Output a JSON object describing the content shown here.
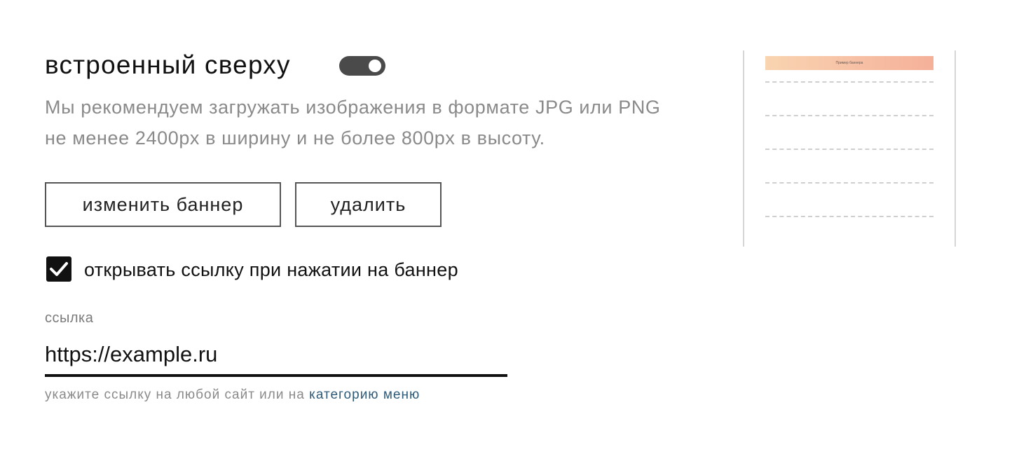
{
  "section": {
    "title": "встроенный сверху",
    "toggle_enabled": true
  },
  "description": {
    "line1": "Мы рекомендуем загружать изображения в формате JPG или PNG",
    "line2": "не менее 2400px в ширину и не более 800px в высоту."
  },
  "buttons": {
    "change_label": "изменить баннер",
    "delete_label": "удалить"
  },
  "link_option": {
    "checked": true,
    "label": "открывать ссылку при нажатии на баннер"
  },
  "link_field": {
    "label": "ссылка",
    "value": "https://example.ru",
    "hint_text": "укажите ссылку на любой сайт или на ",
    "hint_link": "категорию меню"
  },
  "preview": {
    "banner_text": "Пример баннера"
  },
  "colors": {
    "toggle_bg": "#4a4a4a",
    "checkbox_bg": "#111111",
    "link_color": "#2e5b7a",
    "banner_gradient_start": "#f9d4b1",
    "banner_gradient_end": "#f5b09a"
  }
}
